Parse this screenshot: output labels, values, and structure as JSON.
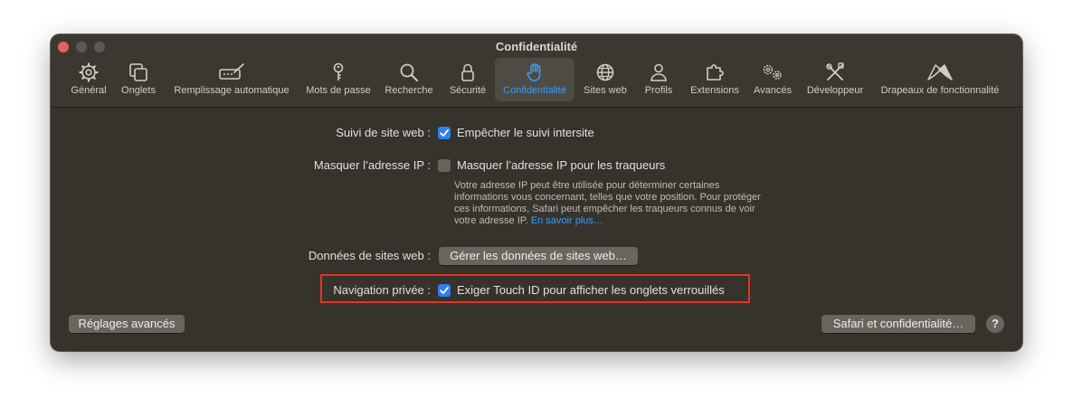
{
  "window": {
    "title": "Confidentialité"
  },
  "toolbar": {
    "items": [
      {
        "label": "Général",
        "icon": "gear-icon"
      },
      {
        "label": "Onglets",
        "icon": "tabs-icon"
      },
      {
        "label": "Remplissage automatique",
        "icon": "autofill-icon"
      },
      {
        "label": "Mots de passe",
        "icon": "key-icon"
      },
      {
        "label": "Recherche",
        "icon": "search-icon"
      },
      {
        "label": "Sécurité",
        "icon": "lock-icon"
      },
      {
        "label": "Confidentialité",
        "icon": "hand-icon"
      },
      {
        "label": "Sites web",
        "icon": "globe-icon"
      },
      {
        "label": "Profils",
        "icon": "person-icon"
      },
      {
        "label": "Extensions",
        "icon": "puzzle-icon"
      },
      {
        "label": "Avancés",
        "icon": "gears-icon"
      },
      {
        "label": "Développeur",
        "icon": "tools-icon"
      },
      {
        "label": "Drapeaux de fonctionnalité",
        "icon": "flags-icon"
      }
    ],
    "active": "Confidentialité"
  },
  "settings": {
    "tracking": {
      "label": "Suivi de site web :",
      "checkbox_label": "Empêcher le suivi intersite",
      "checked": true
    },
    "hide_ip": {
      "label": "Masquer l’adresse IP :",
      "checkbox_label": "Masquer l’adresse IP pour les traqueurs",
      "checked": false,
      "note": "Votre adresse IP peut être utilisée pour déterminer certaines informations vous concernant, telles que votre position. Pour protéger ces informations, Safari peut empêcher les traqueurs connus de voir votre adresse IP.",
      "learn_more": "En savoir plus…"
    },
    "website_data": {
      "label": "Données de sites web :",
      "button_label": "Gérer les données de sites web…"
    },
    "private_browsing": {
      "label": "Navigation privée :",
      "checkbox_label": "Exiger Touch ID pour afficher les onglets verrouillés",
      "checked": true
    }
  },
  "footer": {
    "advanced_button": "Réglages avancés",
    "safari_privacy_button": "Safari et confidentialité…",
    "help": "?"
  },
  "colors": {
    "accent": "#3b9cf5",
    "checkbox_checked": "#2f7ff0",
    "highlight_border": "#e8321c",
    "window_bg": "#35332c"
  }
}
